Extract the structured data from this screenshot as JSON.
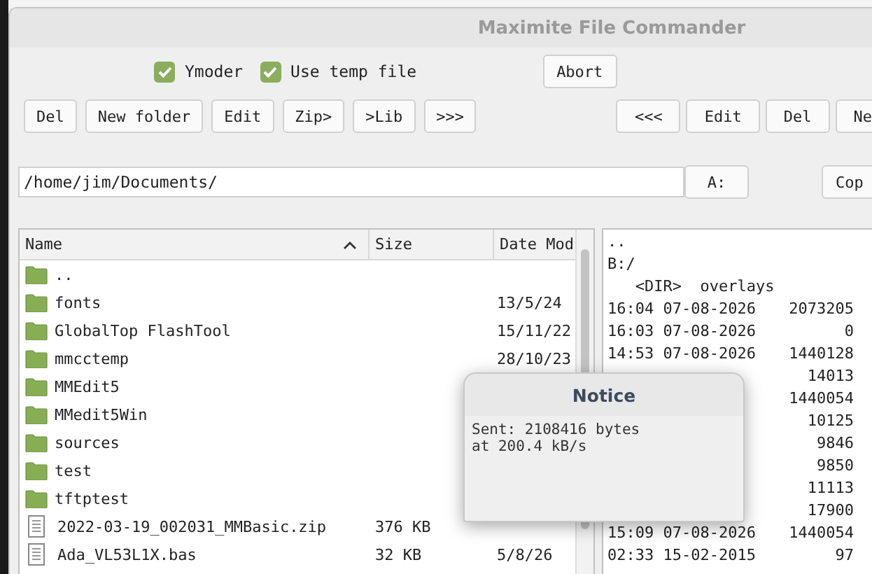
{
  "window": {
    "title": "Maximite File Commander"
  },
  "options": [
    {
      "label": "Ymoder",
      "checked": true
    },
    {
      "label": "Use temp file",
      "checked": true
    }
  ],
  "abort_button": "Abort",
  "left_buttons": [
    "Del",
    "New folder",
    "Edit",
    "Zip>",
    ">Lib",
    ">>>"
  ],
  "right_buttons": [
    "<<<",
    "Edit",
    "Del",
    "Ne"
  ],
  "path": {
    "value": "/home/jim/Documents/"
  },
  "drive_button": "A:",
  "copy_button": "Cop",
  "table": {
    "columns": [
      "Name",
      "Size",
      "Date Mod"
    ],
    "rows": [
      {
        "kind": "folder",
        "name": "..",
        "size": "",
        "date": ""
      },
      {
        "kind": "folder",
        "name": "fonts",
        "size": "",
        "date": "13/5/24"
      },
      {
        "kind": "folder",
        "name": "GlobalTop FlashTool",
        "size": "",
        "date": "15/11/22"
      },
      {
        "kind": "folder",
        "name": "mmcctemp",
        "size": "",
        "date": "28/10/23"
      },
      {
        "kind": "folder",
        "name": "MMEdit5",
        "size": "",
        "date": ""
      },
      {
        "kind": "folder",
        "name": "MMedit5Win",
        "size": "",
        "date": ""
      },
      {
        "kind": "folder",
        "name": "sources",
        "size": "",
        "date": ""
      },
      {
        "kind": "folder",
        "name": "test",
        "size": "",
        "date": ""
      },
      {
        "kind": "folder",
        "name": "tftptest",
        "size": "",
        "date": ""
      },
      {
        "kind": "file",
        "name": "2022-03-19_002031_MMBasic.zip",
        "size": "376 KB",
        "date": ""
      },
      {
        "kind": "file",
        "name": "Ada_VL53L1X.bas",
        "size": "32 KB",
        "date": "5/8/26"
      }
    ]
  },
  "remote_list": {
    "header_lines": [
      "..",
      "B:/",
      "   <DIR>  overlays"
    ],
    "rows": [
      {
        "time_date": "16:04 07-08-2026",
        "size": "2073205"
      },
      {
        "time_date": "16:03 07-08-2026",
        "size": "0"
      },
      {
        "time_date": "14:53 07-08-2026",
        "size": "1440128"
      },
      {
        "size": "14013"
      },
      {
        "size": "1440054"
      },
      {
        "size": "10125"
      },
      {
        "size": "9846"
      },
      {
        "size": "9850"
      },
      {
        "size": "11113"
      },
      {
        "size": "17900"
      },
      {
        "time_date": "15:09 07-08-2026",
        "size": "1440054"
      },
      {
        "time_date": "02:33 15-02-2015",
        "size": "97"
      }
    ]
  },
  "dialog": {
    "title": "Notice",
    "lines": [
      "Sent: 2108416 bytes",
      "at 200.4 kB/s"
    ]
  }
}
